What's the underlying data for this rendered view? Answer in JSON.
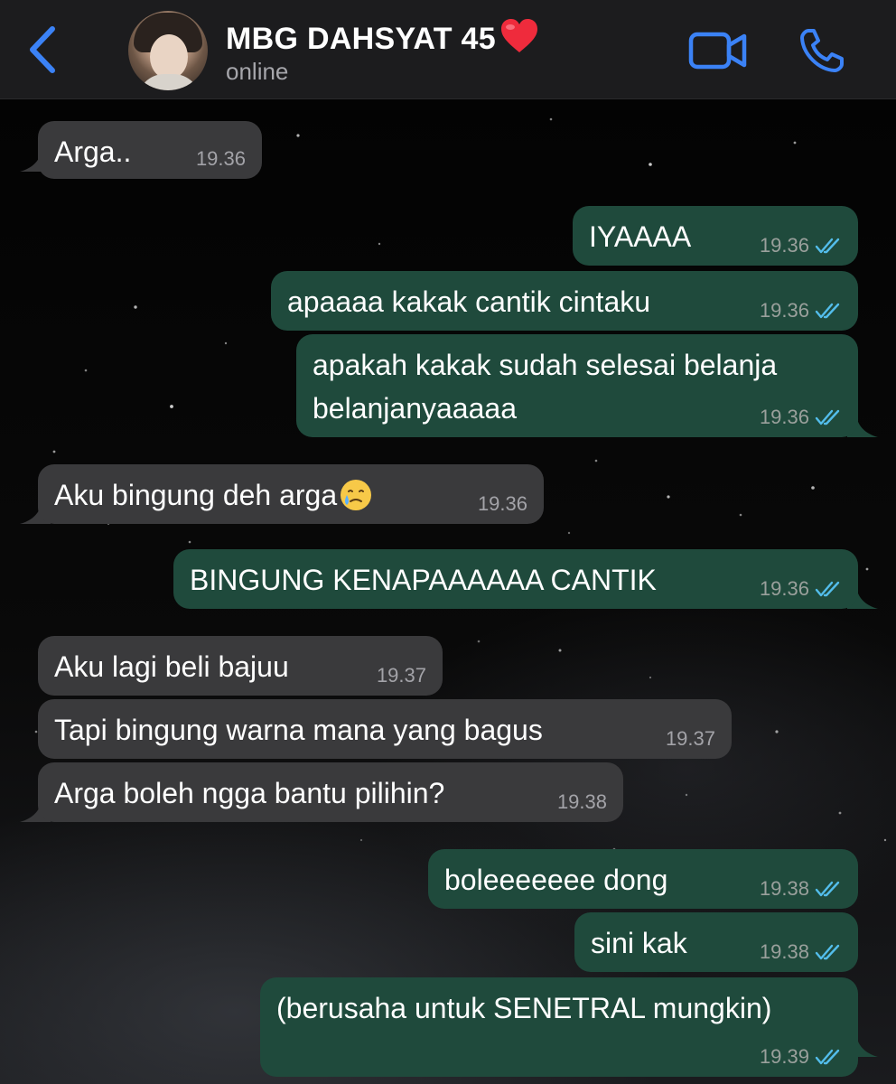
{
  "header": {
    "name": "MBG DAHSYAT 45",
    "status": "online",
    "heart_icon": "red-heart-emoji",
    "accent": "#3b82f6"
  },
  "colors": {
    "incoming_bubble": "#3a3a3c",
    "outgoing_bubble": "#1f4a3c",
    "read_tick": "#53bdeb"
  },
  "messages": [
    {
      "dir": "in",
      "text": "Arga..",
      "time": "19.36"
    },
    {
      "dir": "out",
      "text": "IYAAAA",
      "time": "19.36",
      "read": true
    },
    {
      "dir": "out",
      "text": "apaaaa kakak cantik cintaku",
      "time": "19.36",
      "read": true
    },
    {
      "dir": "out",
      "text": "apakah kakak sudah selesai belanja belanjanyaaaaa",
      "time": "19.36",
      "read": true
    },
    {
      "dir": "in",
      "text": "Aku bingung deh arga",
      "emoji": "face-holding-back-tears",
      "time": "19.36"
    },
    {
      "dir": "out",
      "text": "BINGUNG KENAPAAAAAA CANTIK",
      "time": "19.36",
      "read": true
    },
    {
      "dir": "in",
      "text": "Aku lagi beli bajuu",
      "time": "19.37"
    },
    {
      "dir": "in",
      "text": "Tapi bingung warna mana yang bagus",
      "time": "19.37"
    },
    {
      "dir": "in",
      "text": "Arga boleh ngga bantu pilihin?",
      "time": "19.38"
    },
    {
      "dir": "out",
      "text": "boleeeeeee dong",
      "time": "19.38",
      "read": true
    },
    {
      "dir": "out",
      "text": "sini kak",
      "time": "19.38",
      "read": true
    },
    {
      "dir": "out",
      "text": "(berusaha untuk SENETRAL mungkin)",
      "time": "19.39",
      "read": true
    }
  ]
}
